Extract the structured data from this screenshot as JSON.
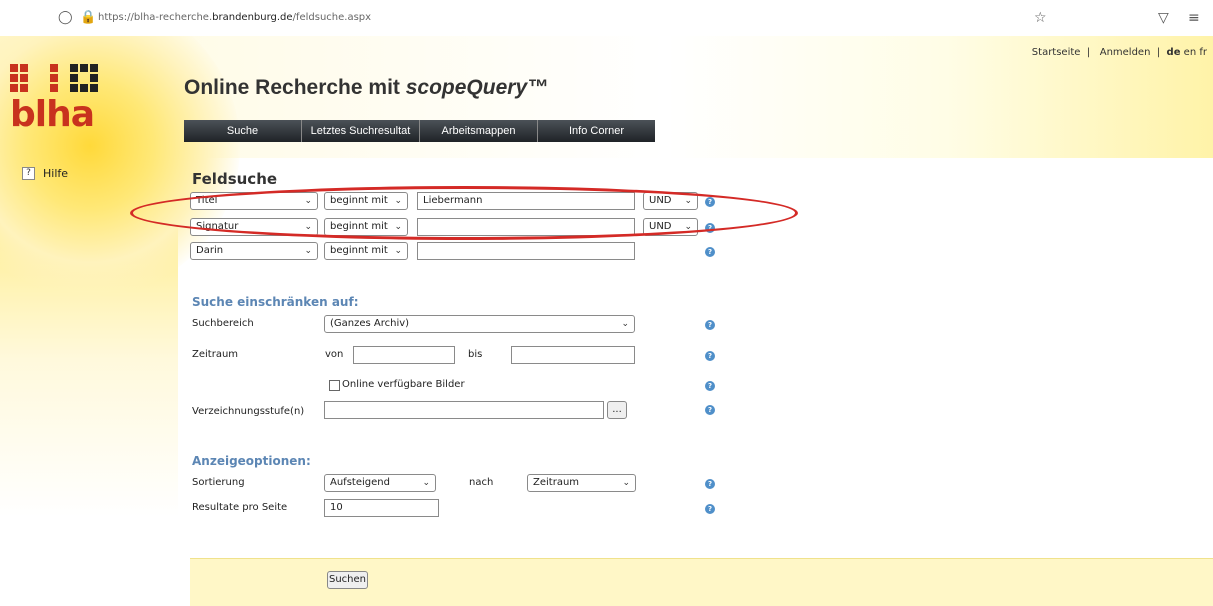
{
  "browser": {
    "url_prefix": "https://blha-recherche.",
    "url_domain": "brandenburg.de",
    "url_suffix": "/feldsuche.aspx"
  },
  "header": {
    "logo_text": "blha",
    "title_main": "Online Recherche mit ",
    "title_brand": "scopeQuery™",
    "top_links": {
      "start": "Startseite",
      "sep1": "|",
      "login": "Anmelden",
      "sep2": "|",
      "lang_de": "de",
      "lang_en": "en",
      "lang_fr": "fr"
    },
    "menu": [
      "Suche",
      "Letztes Suchresultat",
      "Arbeitsmappen",
      "Info Corner"
    ]
  },
  "sidebar": {
    "help_label": "Hilfe",
    "help_icon": "?"
  },
  "feldsuche": {
    "heading": "Feldsuche",
    "rows": [
      {
        "field": "Titel",
        "operator": "beginnt mit",
        "value": "Liebermann",
        "logic": "UND"
      },
      {
        "field": "Signatur",
        "operator": "beginnt mit",
        "value": "",
        "logic": "UND"
      },
      {
        "field": "Darin",
        "operator": "beginnt mit",
        "value": "",
        "logic": ""
      }
    ]
  },
  "restrict": {
    "heading": "Suche einschränken auf:",
    "suchbereich_label": "Suchbereich",
    "suchbereich_value": "(Ganzes Archiv)",
    "zeitraum_label": "Zeitraum",
    "von_label": "von",
    "bis_label": "bis",
    "von_value": "",
    "bis_value": "",
    "bilder_label": "Online verfügbare Bilder",
    "verzeichnung_label": "Verzeichnungsstufe(n)",
    "verzeichnung_value": "",
    "browse_label": "..."
  },
  "display": {
    "heading": "Anzeigeoptionen:",
    "sortierung_label": "Sortierung",
    "sort_order": "Aufsteigend",
    "nach_label": "nach",
    "sort_field": "Zeitraum",
    "resultate_label": "Resultate pro Seite",
    "resultate_value": "10"
  },
  "submit_label": "Suchen",
  "colors": {
    "accent_red": "#d42a26",
    "section_blue": "#5c86b4",
    "help_blue": "#4f8fc9",
    "logo_red": "#c8321e"
  }
}
